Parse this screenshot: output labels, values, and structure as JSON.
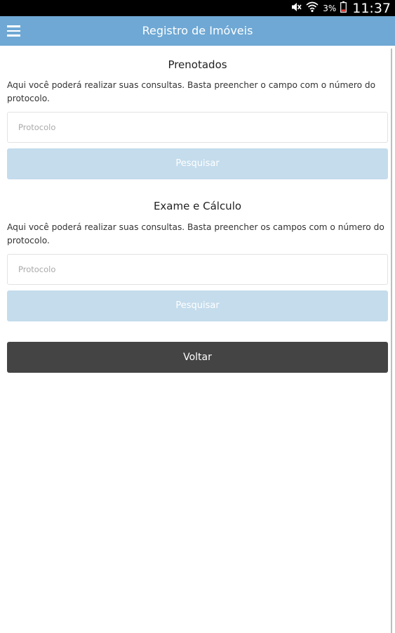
{
  "status_bar": {
    "battery_percent": "3%",
    "time": "11:37"
  },
  "app_bar": {
    "title": "Registro de Imóveis"
  },
  "sections": [
    {
      "title": "Prenotados",
      "description": "Aqui você poderá realizar suas consultas. Basta preencher o campo com o número do protocolo.",
      "input_placeholder": "Protocolo",
      "button_label": "Pesquisar"
    },
    {
      "title": "Exame e Cálculo",
      "description": "Aqui você poderá realizar suas consultas. Basta preencher os campos com o número do protocolo.",
      "input_placeholder": "Protocolo",
      "button_label": "Pesquisar"
    }
  ],
  "back_button_label": "Voltar",
  "colors": {
    "app_bar": "#6fa8d4",
    "search_button_disabled": "#c4dcec",
    "back_button": "#444444"
  }
}
